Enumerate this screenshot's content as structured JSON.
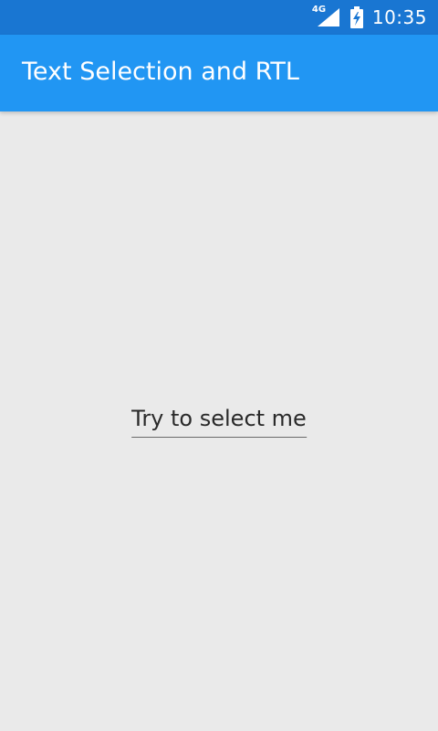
{
  "status_bar": {
    "network_type": "4G",
    "time": "10:35",
    "icons": [
      "signal-icon",
      "battery-charging-icon"
    ]
  },
  "app_bar": {
    "title": "Text Selection and RTL"
  },
  "content": {
    "selectable_text": "Try to select me"
  },
  "colors": {
    "status_bar": "#1976d2",
    "app_bar": "#2196f3",
    "background": "#eaeaea",
    "text": "#2a2a2a"
  }
}
